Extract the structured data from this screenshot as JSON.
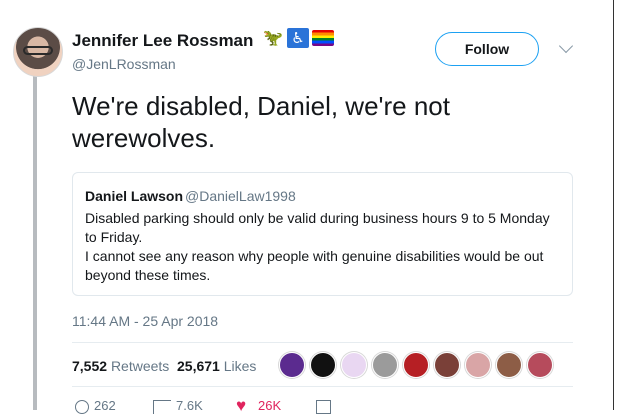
{
  "tweet": {
    "author_name": "Jennifer Lee Rossman",
    "handle": "@JenLRossman",
    "name_emoji": [
      {
        "char": "🦖",
        "icon": "dinosaur-icon"
      },
      {
        "char": "♿",
        "icon": "accessibility-icon"
      },
      {
        "char": "",
        "icon": "rainbow-flag-icon"
      }
    ],
    "follow_label": "Follow",
    "text": "We're disabled, Daniel, we're not werewolves.",
    "timestamp": "11:44 AM - 25 Apr 2018"
  },
  "quoted_tweet": {
    "author_name": "Daniel Lawson",
    "handle": "@DanielLaw1998",
    "lines": [
      "Disabled parking should only be valid during business hours 9 to 5 Monday",
      "to Friday.",
      "I cannot see any reason why people with genuine disabilities would be out",
      "beyond these times."
    ]
  },
  "stats": {
    "retweets_count": "7,552",
    "retweets_label": "Retweets",
    "likes_count": "25,671",
    "likes_label": "Likes"
  },
  "liker_avatars": [
    {
      "name": "purple-avatar",
      "color": "#5b2b8f"
    },
    {
      "name": "black-avatar",
      "color": "#111111"
    },
    {
      "name": "pastel-avatar",
      "color": "#e9d7f2"
    },
    {
      "name": "gray-avatar",
      "color": "#9b9b9b"
    },
    {
      "name": "red-avatar",
      "color": "#b61f24"
    },
    {
      "name": "portrait-avatar-1",
      "color": "#7a4038"
    },
    {
      "name": "portrait-avatar-2",
      "color": "#d9a5a6"
    },
    {
      "name": "portrait-avatar-3",
      "color": "#8d5d46"
    },
    {
      "name": "portrait-avatar-4",
      "color": "#b64b5c"
    }
  ],
  "actions": {
    "reply_count": "262",
    "retweet_count": "7.6K",
    "like_count": "26K"
  },
  "colors": {
    "link_blue": "#1da1f2",
    "text_gray": "#657786",
    "like_red": "#e0245e"
  }
}
